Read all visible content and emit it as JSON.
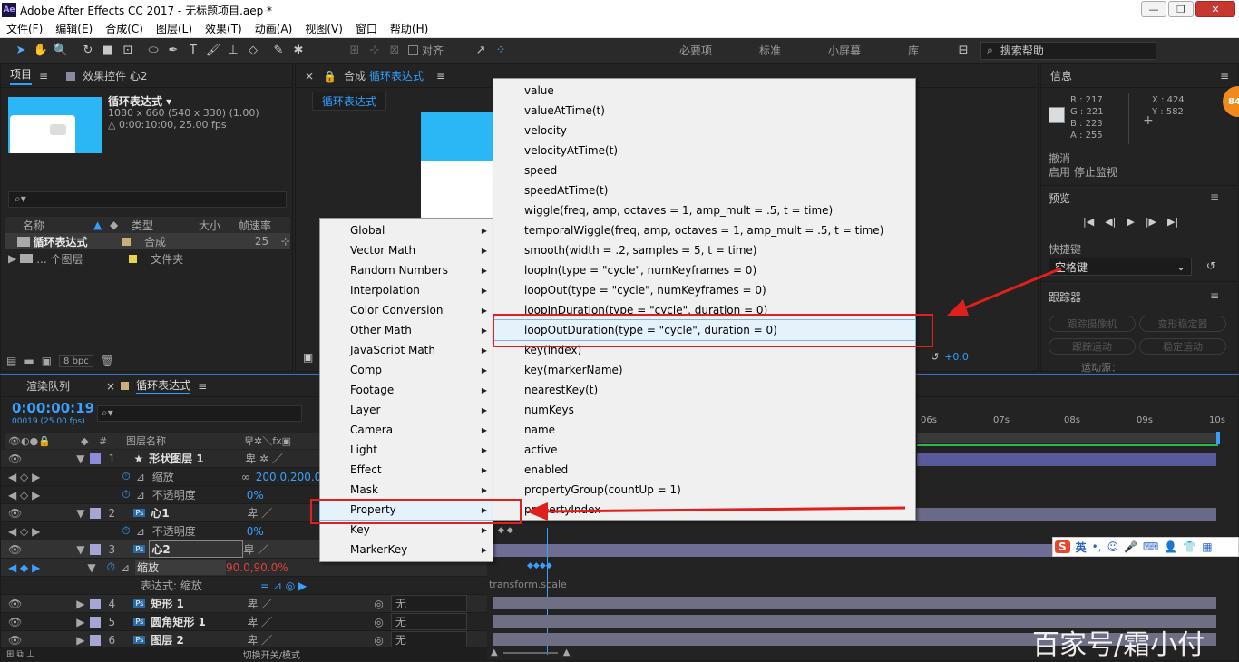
{
  "window": {
    "app_icon": "Ae",
    "title": "Adobe After Effects CC 2017 - 无标题项目.aep *",
    "min": "—",
    "max": "❐",
    "close": "✕"
  },
  "menubar": [
    "文件(F)",
    "编辑(E)",
    "合成(C)",
    "图层(L)",
    "效果(T)",
    "动画(A)",
    "视图(V)",
    "窗口",
    "帮助(H)"
  ],
  "toolbar": {
    "align_label": "对齐",
    "workspaces": [
      "必要项",
      "标准",
      "小屏幕",
      "库"
    ],
    "search_placeholder": "搜索帮助"
  },
  "project": {
    "tab_project": "项目",
    "tab_effects": "效果控件 心2",
    "comp_name": "循环表达式 ▾",
    "comp_size": "1080 x 660  (540 x 330) (1.00)",
    "comp_duration": "△ 0:00:10:00, 25.00 fps",
    "search_placeholder": "",
    "columns": [
      "名称",
      "类型",
      "大小",
      "帧速率"
    ],
    "rows": [
      {
        "name": "循环表达式",
        "type": "合成",
        "fps": "25",
        "color": "#c9b07a"
      },
      {
        "name": "... 个图层",
        "type": "文件夹",
        "fps": "",
        "color": "#e8d34a"
      }
    ],
    "bpc": "8 bpc"
  },
  "composition": {
    "tab_prefix": "合成",
    "tab_name": "循环表达式",
    "sub_tab": "循环表达式",
    "exposure": "+0.0"
  },
  "info": {
    "title": "信息",
    "r": "R : 217",
    "g": "G : 221",
    "b": "B : 223",
    "a": "A : 255",
    "x": "X : 424",
    "y": "Y : 582",
    "undo": "撤消",
    "status": "启用 停止监视",
    "badge": "84"
  },
  "preview": {
    "title": "预览",
    "shortcut_label": "快捷键",
    "shortcut_value": "空格键"
  },
  "tracker": {
    "title": "跟踪器",
    "buttons": [
      "跟踪摄像机",
      "变形稳定器",
      "跟踪运动",
      "稳定运动"
    ],
    "source": "运动源："
  },
  "timeline": {
    "tab_render": "渲染队列",
    "tab_comp": "循环表达式",
    "timecode": "0:00:00:19",
    "frame_info": "00019 (25.00 fps)",
    "layer_col": "图层名称",
    "num_col": "#",
    "ruler": [
      "06s",
      "07s",
      "08s",
      "09s",
      "10s"
    ],
    "layers": [
      {
        "num": "1",
        "name": "形状图层 1",
        "icon": "★",
        "color": "#8c8cd8"
      },
      {
        "prop": "缩放",
        "value": "200.0,200.0%"
      },
      {
        "prop": "不透明度",
        "value": "0%"
      },
      {
        "num": "2",
        "name": "心1",
        "icon": "Ps",
        "color": "#a6a6d6"
      },
      {
        "prop": "不透明度",
        "value": "0%"
      },
      {
        "num": "3",
        "name": "心2",
        "icon": "Ps",
        "color": "#a6a6d6"
      },
      {
        "prop": "缩放",
        "value": "90.0,90.0%"
      },
      {
        "expr_label": "表达式: 缩放"
      },
      {
        "num": "4",
        "name": "矩形 1",
        "icon": "Ps",
        "color": "#a6a6d6",
        "parent": "无"
      },
      {
        "num": "5",
        "name": "圆角矩形 1",
        "icon": "Ps",
        "color": "#a6a6d6",
        "parent": "无"
      },
      {
        "num": "6",
        "name": "图层 2",
        "icon": "Ps",
        "color": "#a6a6d6",
        "parent": "无"
      }
    ],
    "expr_text": "transform.scale",
    "switch_mode": "切换开关/模式"
  },
  "menu_categories": [
    "Global",
    "Vector Math",
    "Random Numbers",
    "Interpolation",
    "Color Conversion",
    "Other Math",
    "JavaScript Math",
    "Comp",
    "Footage",
    "Layer",
    "Camera",
    "Light",
    "Effect",
    "Mask",
    "Property",
    "Key",
    "MarkerKey"
  ],
  "menu_property": [
    "value",
    "valueAtTime(t)",
    "velocity",
    "velocityAtTime(t)",
    "speed",
    "speedAtTime(t)",
    "wiggle(freq, amp, octaves = 1, amp_mult = .5, t = time)",
    "temporalWiggle(freq, amp, octaves = 1, amp_mult = .5, t = time)",
    "smooth(width = .2, samples = 5, t = time)",
    "loopIn(type = \"cycle\", numKeyframes = 0)",
    "loopOut(type = \"cycle\", numKeyframes = 0)",
    "loopInDuration(type = \"cycle\", duration = 0)",
    "loopOutDuration(type = \"cycle\", duration = 0)",
    "key(index)",
    "key(markerName)",
    "nearestKey(t)",
    "numKeys",
    "name",
    "active",
    "enabled",
    "propertyGroup(countUp = 1)",
    "propertyIndex"
  ],
  "ime": {
    "logo": "S",
    "lang": "英",
    "icons": [
      "•,",
      "☺",
      "🎤",
      "⌨",
      "👤",
      "👕",
      "▦"
    ]
  },
  "watermark": "百家号/霜小付",
  "colors": {
    "accent_blue": "#2ea0ff",
    "annotation_red": "#e0201c",
    "timecode": "#3aa0ff"
  }
}
